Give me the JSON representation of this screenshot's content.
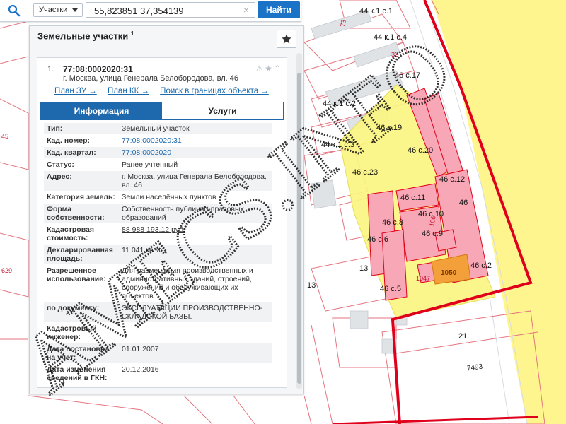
{
  "search": {
    "scope": "Участки",
    "value": "55,823851 37,354139",
    "clear_symbol": "×",
    "find_label": "Найти"
  },
  "panel": {
    "title": "Земельные участки",
    "title_sup": "1",
    "item": {
      "number": "1.",
      "cad_number": "77:08:0002020:31",
      "address_line": "г. Москва, улица Генерала Белобородова, вл. 46",
      "icons": "⚠★⌃",
      "links": [
        "План ЗУ →",
        "План КК →",
        "Поиск в границах объекта →"
      ]
    },
    "tabs": [
      "Информация",
      "Услуги"
    ],
    "attrs": [
      {
        "k": "Тип:",
        "v": "Земельный участок"
      },
      {
        "k": "Кад. номер:",
        "v": "77:08:0002020:31"
      },
      {
        "k": "Кад. квартал:",
        "v": "77:08:0002020"
      },
      {
        "k": "Статус:",
        "v": "Ранее учтенный"
      },
      {
        "k": "Адрес:",
        "v": "г. Москва, улица Генерала Белобородова, вл. 46"
      },
      {
        "k": "Категория земель:",
        "v": "Земли населённых пунктов"
      },
      {
        "k": "Форма собственности:",
        "v": "Собственность публично-правовых образований"
      },
      {
        "k": "Кадастровая стоимость:",
        "v": "88 988 193,12 руб."
      },
      {
        "k": "Декларированная площадь:",
        "v": "11 041 кв.м"
      },
      {
        "k": "Разрешенное использование:",
        "v": "Для размещения производственных и административных зданий, строений, сооружений и обслуживающих их объектов"
      },
      {
        "k": "по документу:",
        "v": "ЭКСПЛУАТАЦИИ ПРОИЗВОДСТВЕННО-СКЛАДСКОЙ БАЗЫ."
      },
      {
        "k": "Кадастровый инженер:",
        "v": ""
      },
      {
        "k": "Дата постановки на учет:",
        "v": "01.01.2007"
      },
      {
        "k": "Дата изменения сведений в ГКН:",
        "v": "20.12.2016"
      }
    ]
  },
  "map_labels": [
    {
      "t": "44 к.1 с.1"
    },
    {
      "t": "44 к.1 с.4"
    },
    {
      "t": "44 к.1 с.2"
    },
    {
      "t": "44 к.1 с.3"
    },
    {
      "t": "46 с.17"
    },
    {
      "t": "46 с.19"
    },
    {
      "t": "46 с.20"
    },
    {
      "t": "46 с.23"
    },
    {
      "t": "46 с.12"
    },
    {
      "t": "46 с.11"
    },
    {
      "t": "46 с.8"
    },
    {
      "t": "46 с.10"
    },
    {
      "t": "46 с.6"
    },
    {
      "t": "46 с.9"
    },
    {
      "t": "46 с.2"
    },
    {
      "t": "46 с.5"
    },
    {
      "t": "46"
    },
    {
      "t": "13"
    },
    {
      "t": "13"
    },
    {
      "t": "21"
    },
    {
      "t": "7493"
    },
    {
      "t": "1050"
    },
    {
      "t": "32"
    },
    {
      "t": "73"
    },
    {
      "t": "45"
    },
    {
      "t": "629"
    },
    {
      "t": "106"
    },
    {
      "t": "1047"
    }
  ],
  "watermark_text": "AMECS.INFO",
  "colors": {
    "brand_blue": "#1e69ad",
    "parcel_red": "#e0001b",
    "highlight_yellow": "#fbf580",
    "building_pink": "#f7a7b6",
    "road_yellow": "#fff58f"
  }
}
